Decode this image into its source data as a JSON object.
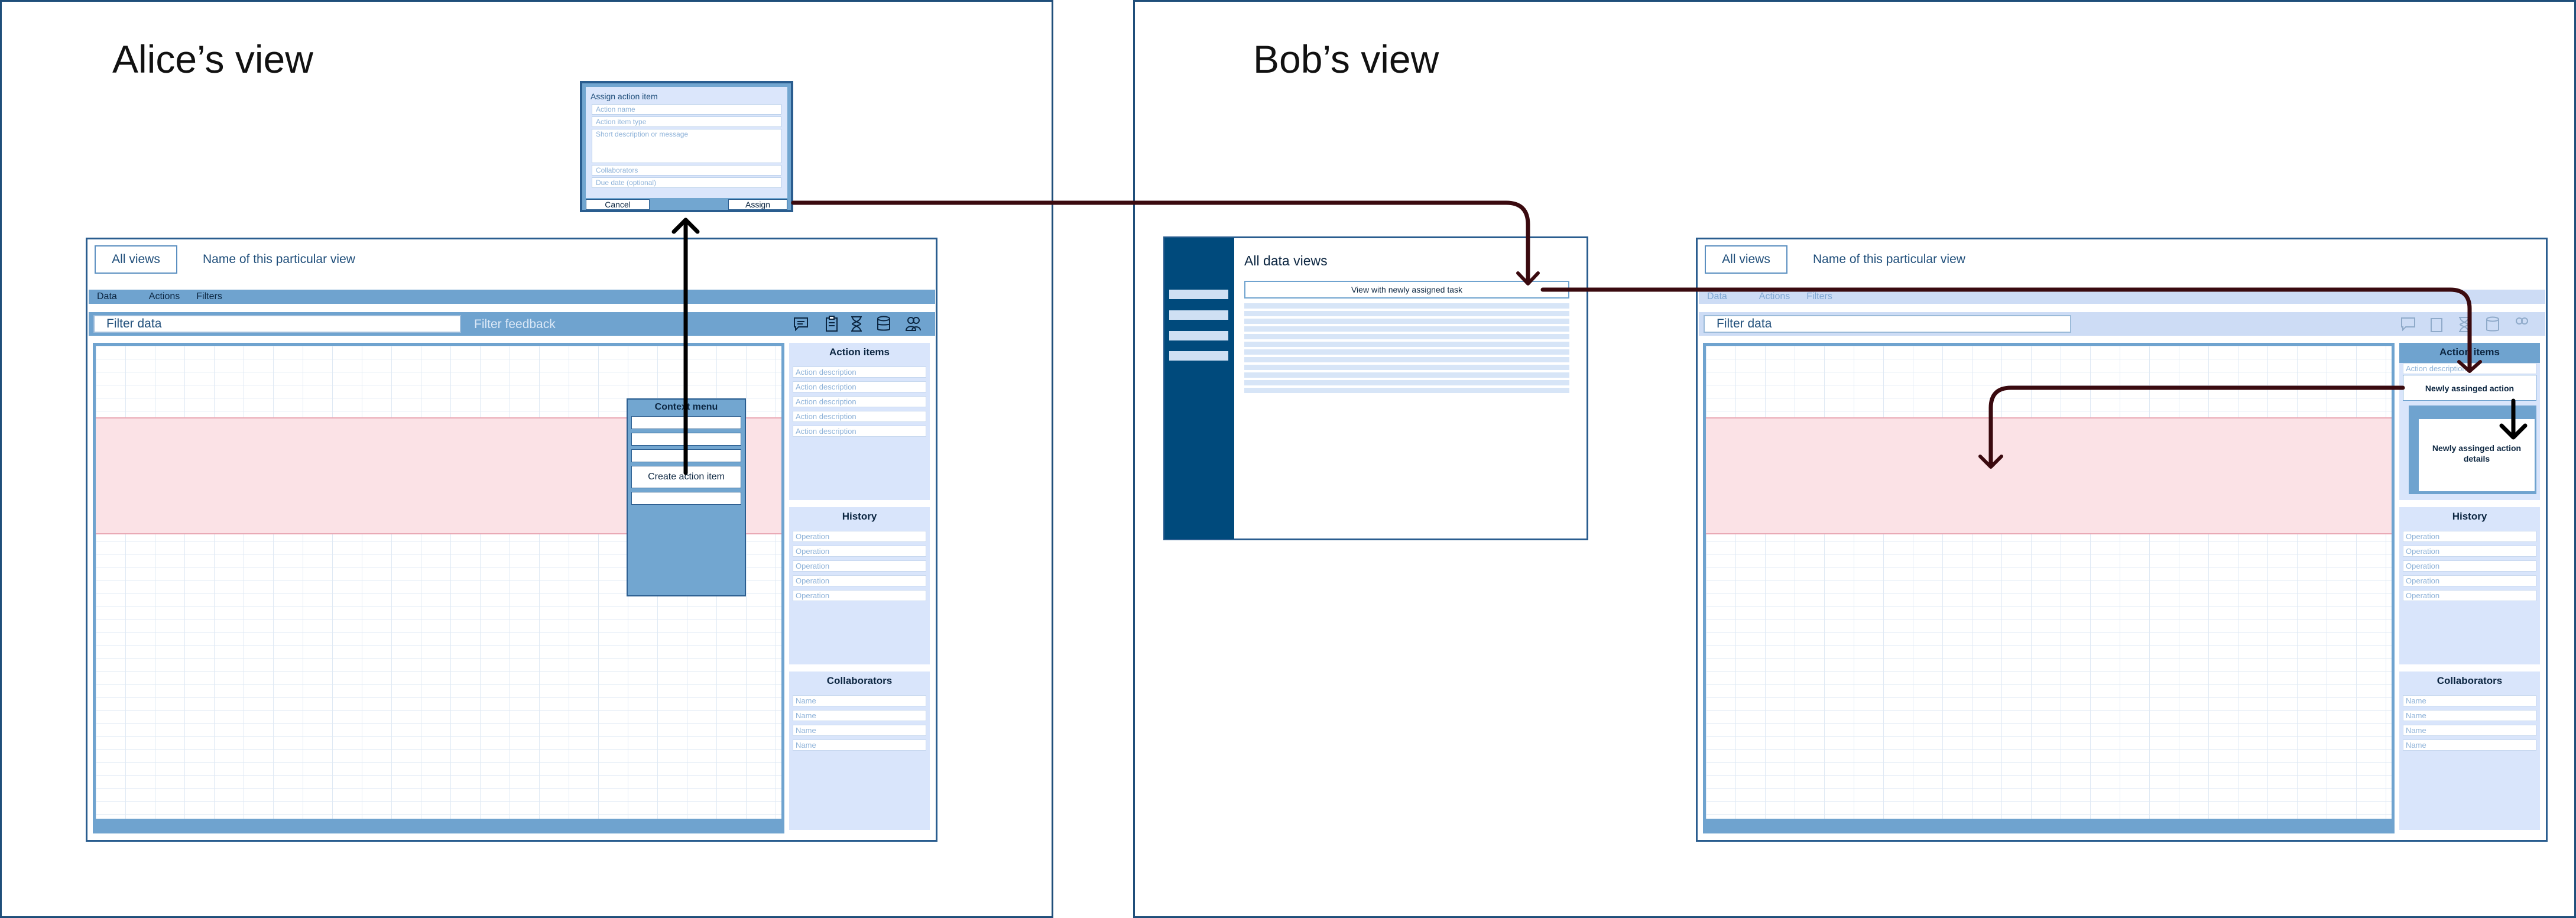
{
  "alice": {
    "title": "Alice’s view",
    "all_views_label": "All views",
    "view_name": "Name of this particular view",
    "menu": [
      "Data",
      "Actions",
      "Filters"
    ],
    "filter_placeholder": "Filter data",
    "filter_feedback": "Filter feedback",
    "toolbar_icons": [
      "chat-icon",
      "clipboard-icon",
      "hourglass-icon",
      "database-icon",
      "users-icon"
    ],
    "action_items": {
      "title": "Action items",
      "rows": [
        "Action description",
        "Action description",
        "Action description",
        "Action description",
        "Action description"
      ]
    },
    "history": {
      "title": "History",
      "rows": [
        "Operation",
        "Operation",
        "Operation",
        "Operation",
        "Operation"
      ]
    },
    "collaborators": {
      "title": "Collaborators",
      "rows": [
        "Name",
        "Name",
        "Name",
        "Name"
      ]
    },
    "context_menu": {
      "title": "Context menu",
      "create_label": "Create action item"
    },
    "dialog": {
      "title": "Assign action item",
      "fields": [
        "Action name",
        "Action item type",
        "Short description or message",
        "Collaborators",
        "Due date (optional)"
      ],
      "cancel": "Cancel",
      "assign": "Assign"
    }
  },
  "bob": {
    "title": "Bob’s view",
    "data_views": {
      "title": "All data views",
      "new_item": "View with newly assigned task"
    },
    "all_views_label": "All views",
    "view_name": "Name of this particular view",
    "menu": [
      "Data",
      "Actions",
      "Filters"
    ],
    "filter_placeholder": "Filter data",
    "action_items": {
      "title": "Action items",
      "first_row": "Action description",
      "new_action": "Newly assinged action",
      "details": "Newly assinged action details"
    },
    "history": {
      "title": "History",
      "rows": [
        "Operation",
        "Operation",
        "Operation",
        "Operation",
        "Operation"
      ]
    },
    "collaborators": {
      "title": "Collaborators",
      "rows": [
        "Name",
        "Name",
        "Name",
        "Name"
      ]
    }
  },
  "colors": {
    "frame": "#1f4e7a",
    "menu": "#6fa3cf",
    "panel": "#d9e5fb",
    "highlight": "#fbe2e6",
    "arrow": "#3a0a0f",
    "sidebar": "#004a7c"
  }
}
